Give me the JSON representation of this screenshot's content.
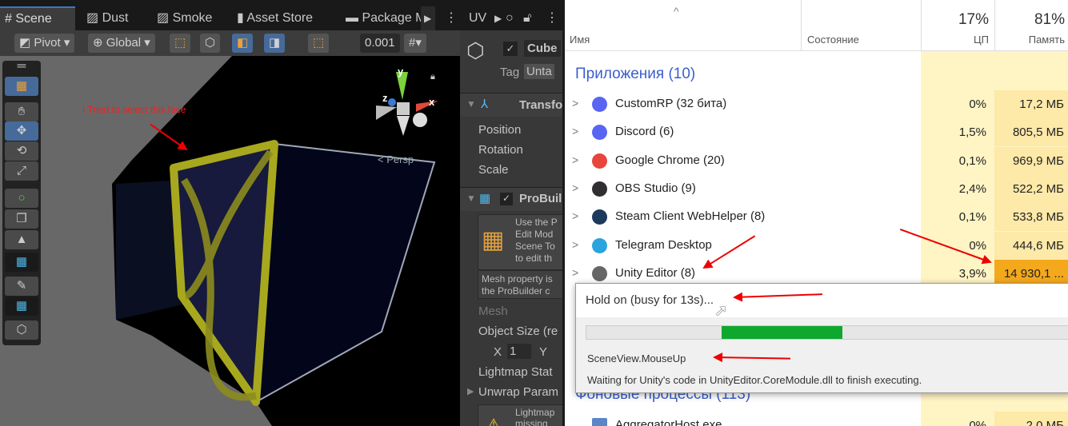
{
  "unity": {
    "tabs": [
      {
        "label": "# Scene"
      },
      {
        "label": "Dust"
      },
      {
        "label": "Smoke"
      },
      {
        "label": "Asset Store"
      },
      {
        "label": "Package M"
      }
    ],
    "inspector_tab": "UV",
    "toolbar": {
      "pivot": "Pivot",
      "global": "Global",
      "snap_value": "0.001"
    },
    "scene": {
      "annotation": "I Tried to select this face",
      "persp_label": "< Persp",
      "axes": {
        "x": "x",
        "y": "y",
        "z": "z"
      }
    },
    "inspector": {
      "object_name": "Cube",
      "tag_label": "Tag",
      "tag_value": "Unta",
      "transform_title": "Transfo",
      "position": "Position",
      "rotation": "Rotation",
      "scale": "Scale",
      "probuilder_title": "ProBuil",
      "probuilder_help": [
        "Use the P",
        "Edit Mod",
        "Scene To",
        "to edit th"
      ],
      "mesh_note": [
        "Mesh property is",
        "the ProBuilder c"
      ],
      "mesh": "Mesh",
      "object_size": "Object Size (re",
      "size_x_label": "X",
      "size_x": "1",
      "size_y_label": "Y",
      "lightmap_static": "Lightmap Stat",
      "unwrap": "Unwrap Param",
      "lightmap_warning": [
        "Lightmap",
        "missing"
      ]
    }
  },
  "task_manager": {
    "columns": {
      "name": "Имя",
      "status": "Состояние",
      "cpu_total": "17%",
      "cpu": "ЦП",
      "mem_total": "81%",
      "mem": "Память"
    },
    "group_apps": "Приложения (10)",
    "apps": [
      {
        "name": "CustomRP (32 бита)",
        "cpu": "0%",
        "mem": "17,2 МБ",
        "icon": "discord-icon",
        "color": "#5865f2"
      },
      {
        "name": "Discord (6)",
        "cpu": "1,5%",
        "mem": "805,5 МБ",
        "icon": "discord-icon",
        "color": "#5865f2"
      },
      {
        "name": "Google Chrome (20)",
        "cpu": "0,1%",
        "mem": "969,9 МБ",
        "icon": "chrome-icon",
        "color": "#e8453c"
      },
      {
        "name": "OBS Studio (9)",
        "cpu": "2,4%",
        "mem": "522,2 МБ",
        "icon": "obs-icon",
        "color": "#302e31"
      },
      {
        "name": "Steam Client WebHelper (8)",
        "cpu": "0,1%",
        "mem": "533,8 МБ",
        "icon": "steam-icon",
        "color": "#1b3a5c"
      },
      {
        "name": "Telegram Desktop",
        "cpu": "0%",
        "mem": "444,6 МБ",
        "icon": "telegram-icon",
        "color": "#2aa3de"
      },
      {
        "name": "Unity Editor (8)",
        "cpu": "3,9%",
        "mem": "14 930,1 ...",
        "icon": "unity-icon",
        "color": "#666"
      }
    ],
    "group_background": "Фоновые процессы (113)",
    "bg_row": {
      "name": "AggregatorHost.exe",
      "cpu": "0%",
      "mem": "2,0 МБ"
    }
  },
  "dialog": {
    "title": "Hold on (busy for 13s)...",
    "progress": 0.25,
    "progress_offset": 0.28,
    "task": "SceneView.MouseUp",
    "message": "Waiting for Unity's code in UnityEditor.CoreModule.dll to finish executing.",
    "accent": "#0ea82e"
  }
}
